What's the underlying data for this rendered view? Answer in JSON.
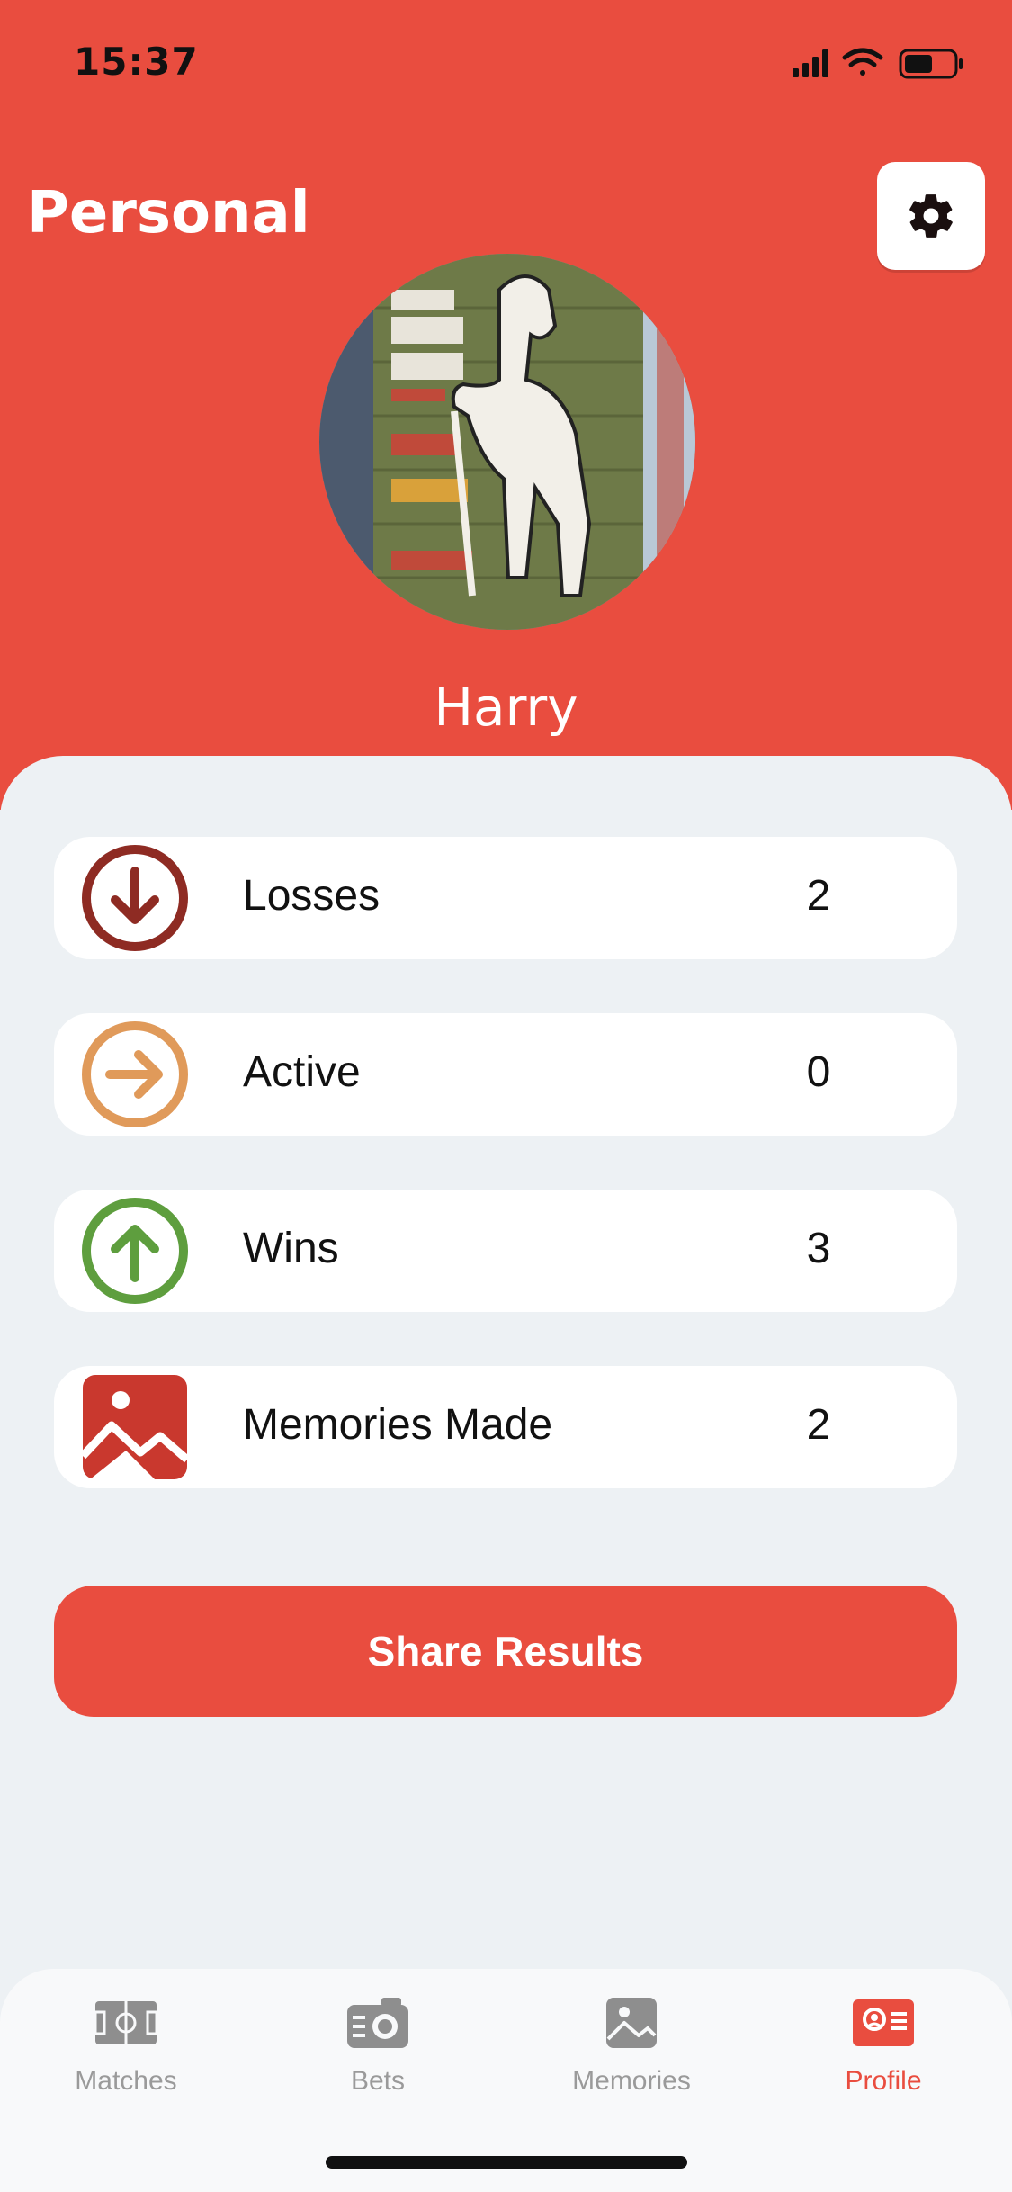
{
  "status_bar": {
    "time": "15:37"
  },
  "header": {
    "title": "Personal",
    "user_name": "Harry"
  },
  "stats": [
    {
      "label": "Losses",
      "value": "2",
      "icon": "arrow-down-circle-icon",
      "color": "#8E2B23"
    },
    {
      "label": "Active",
      "value": "0",
      "icon": "arrow-right-circle-icon",
      "color": "#E09A5A"
    },
    {
      "label": "Wins",
      "value": "3",
      "icon": "arrow-up-circle-icon",
      "color": "#5E9E3E"
    },
    {
      "label": "Memories Made",
      "value": "2",
      "icon": "image-icon",
      "color": "#C9382E"
    }
  ],
  "share_button": {
    "label": "Share Results"
  },
  "tabs": [
    {
      "label": "Matches",
      "icon": "field-icon",
      "active": false
    },
    {
      "label": "Bets",
      "icon": "ticket-icon",
      "active": false
    },
    {
      "label": "Memories",
      "icon": "image-icon",
      "active": false
    },
    {
      "label": "Profile",
      "icon": "profile-card-icon",
      "active": true
    }
  ],
  "colors": {
    "accent": "#E94D3F",
    "background": "#EDF1F4",
    "inactive": "#9A9A9A"
  }
}
